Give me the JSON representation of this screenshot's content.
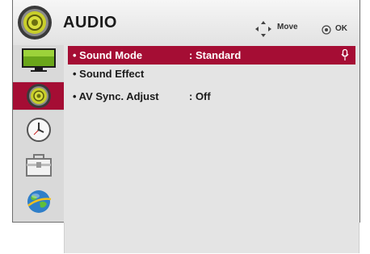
{
  "header": {
    "title": "AUDIO",
    "icon": "speaker-icon",
    "hints": {
      "move_label": "Move",
      "move_icon": "dpad-arrows-icon",
      "ok_label": "OK",
      "ok_icon": "ok-circle-icon"
    }
  },
  "sidebar": {
    "items": [
      {
        "name": "picture",
        "icon": "tv-picture-icon",
        "active": false
      },
      {
        "name": "audio",
        "icon": "speaker-icon",
        "active": true
      },
      {
        "name": "time",
        "icon": "clock-icon",
        "active": false
      },
      {
        "name": "option",
        "icon": "toolbox-icon",
        "active": false
      },
      {
        "name": "network",
        "icon": "globe-icon",
        "active": false
      }
    ]
  },
  "menu": {
    "items": [
      {
        "label": "• Sound Mode",
        "value": ": Standard",
        "selected": true
      },
      {
        "label": "• Sound Effect",
        "value": "",
        "selected": false
      },
      {
        "label": "• AV Sync. Adjust",
        "value": ": Off",
        "selected": false
      }
    ]
  },
  "colors": {
    "accent": "#a50d34",
    "panel": "#e4e4e4",
    "sidebar": "#d9d9d9"
  }
}
